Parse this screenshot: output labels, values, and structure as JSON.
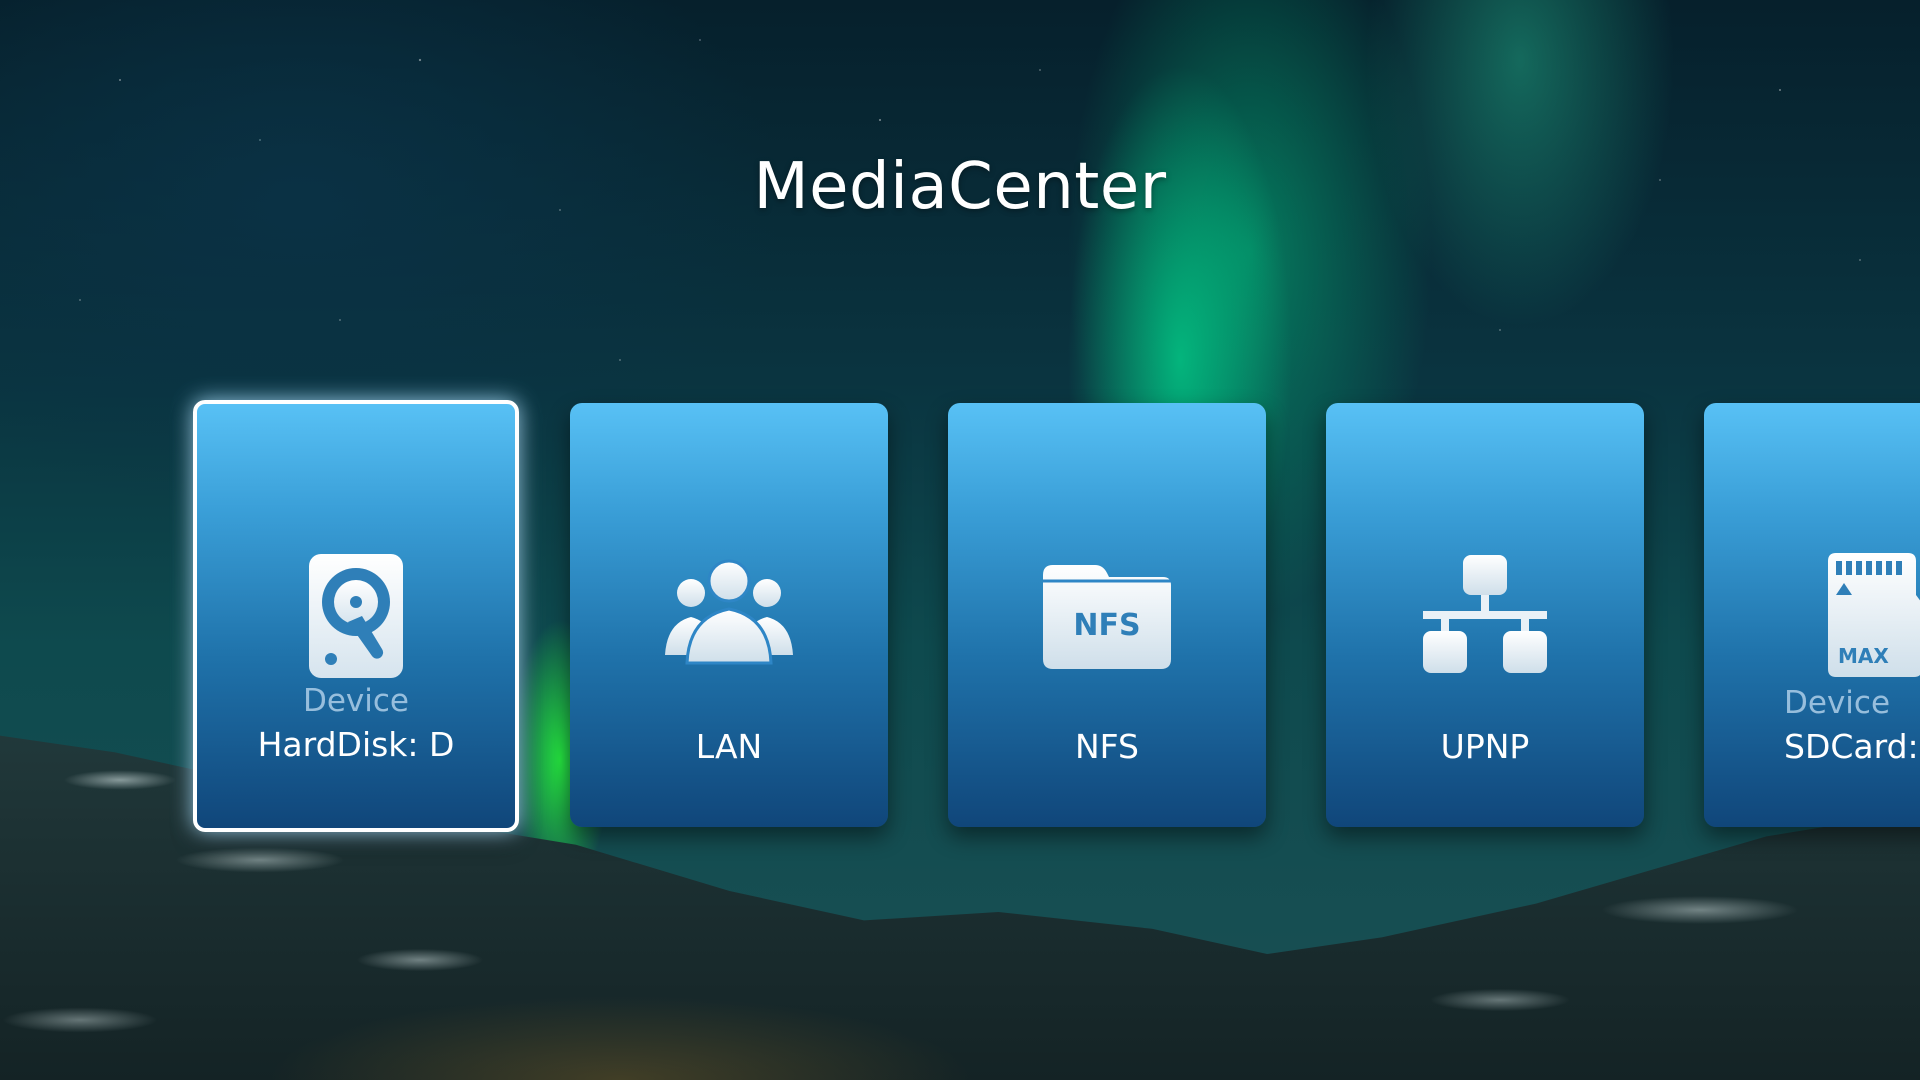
{
  "app": {
    "title": "MediaCenter"
  },
  "sources": [
    {
      "subtitle": "Device",
      "label": "HardDisk: D",
      "icon": "hard-disk-icon",
      "focused": true
    },
    {
      "subtitle": "",
      "label": "LAN",
      "icon": "users-group-icon",
      "focused": false
    },
    {
      "subtitle": "",
      "label": "NFS",
      "icon": "nfs-folder-icon",
      "icon_text": "NFS",
      "focused": false
    },
    {
      "subtitle": "",
      "label": "UPNP",
      "icon": "network-icon",
      "focused": false
    },
    {
      "subtitle": "Device",
      "label": "SDCard:",
      "icon": "sd-card-icon",
      "icon_text": "MAX",
      "focused": false
    }
  ],
  "colors": {
    "tile_top": "#58c1f5",
    "tile_bottom": "#10467a",
    "focus_border": "#ffffff",
    "aurora": "#00ff9c"
  }
}
